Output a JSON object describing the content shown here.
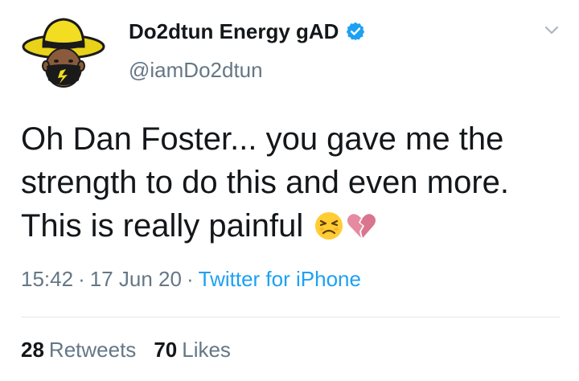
{
  "author": {
    "display_name": "Do2dtun Energy gAD",
    "handle": "@iamDo2dtun",
    "verified": true
  },
  "tweet": {
    "lines": [
      "Oh Dan Foster... you gave me the",
      "strength to do this and even more.",
      "This is really painful"
    ],
    "emojis": [
      "persevering-face-emoji",
      "broken-heart-emoji"
    ]
  },
  "meta": {
    "time": "15:42",
    "separator": "·",
    "date": "17 Jun 20",
    "source": "Twitter for iPhone"
  },
  "stats": {
    "retweets_count": "28",
    "retweets_label": "Retweets",
    "likes_count": "70",
    "likes_label": "Likes"
  },
  "colors": {
    "text": "#14171a",
    "secondary": "#657786",
    "accent": "#1da1f2",
    "divider": "#e1e8ed"
  }
}
